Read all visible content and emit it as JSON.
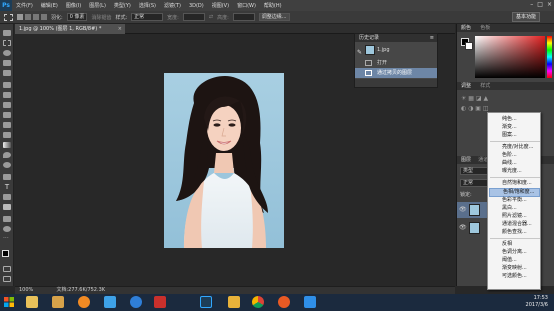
{
  "app": {
    "name": "Ps"
  },
  "menubar": {
    "items": [
      "文件(F)",
      "编辑(E)",
      "图像(I)",
      "图层(L)",
      "类型(Y)",
      "选择(S)",
      "滤镜(T)",
      "3D(D)",
      "视图(V)",
      "窗口(W)",
      "帮助(H)"
    ],
    "window_controls": {
      "minimize": "–",
      "maximize": "□",
      "close": "×"
    }
  },
  "options_bar": {
    "feather_label": "羽化:",
    "feather_value": "0 像素",
    "antialias_label": "消除锯齿",
    "style_label": "样式:",
    "style_value": "正常",
    "width_label": "宽度:",
    "height_label": "高度:",
    "refine_button": "调整边缘...",
    "workspace": "基本功能"
  },
  "document": {
    "tab_title": "1.jpg @ 100% (图层 1, RGB/8#) *",
    "tab_close": "×"
  },
  "status": {
    "zoom": "100%",
    "doc_info": "文档:277.6K/752.3K"
  },
  "history_panel": {
    "title": "历史记录",
    "snapshot": "1.jpg",
    "items": [
      "打开",
      "通过拷贝的图层"
    ]
  },
  "right_panels": {
    "color_tabs": [
      "颜色",
      "色板"
    ],
    "adjust_tabs": [
      "调整",
      "样式"
    ],
    "layers_tabs": [
      "图层",
      "通道",
      "路径"
    ],
    "kind_label": "类型",
    "blend_mode": "正常",
    "opacity_label": "不透明度:",
    "lock_label": "锁定:",
    "fill_label": "填充:",
    "layers": [
      "图层 1",
      "背景"
    ]
  },
  "adjust_menu": {
    "items": [
      "纯色...",
      "渐变...",
      "图案...",
      "亮度/对比度...",
      "色阶...",
      "曲线...",
      "曝光度...",
      "自然饱和度...",
      "色相/饱和度...",
      "色彩平衡...",
      "黑白...",
      "照片滤镜...",
      "通道混合器...",
      "颜色查找...",
      "反相",
      "色调分离...",
      "阈值...",
      "渐变映射...",
      "可选颜色..."
    ],
    "highlighted": "色相/饱和度..."
  },
  "taskbar": {
    "time": "17:53",
    "date": "2017/3/6",
    "apps": [
      "start",
      "file-explorer",
      "media-player",
      "browser-360",
      "app-store",
      "kuwo",
      "word-doc",
      "photoshop",
      "wps-folder",
      "chrome",
      "browser-360-safe",
      "wps-writer"
    ]
  }
}
